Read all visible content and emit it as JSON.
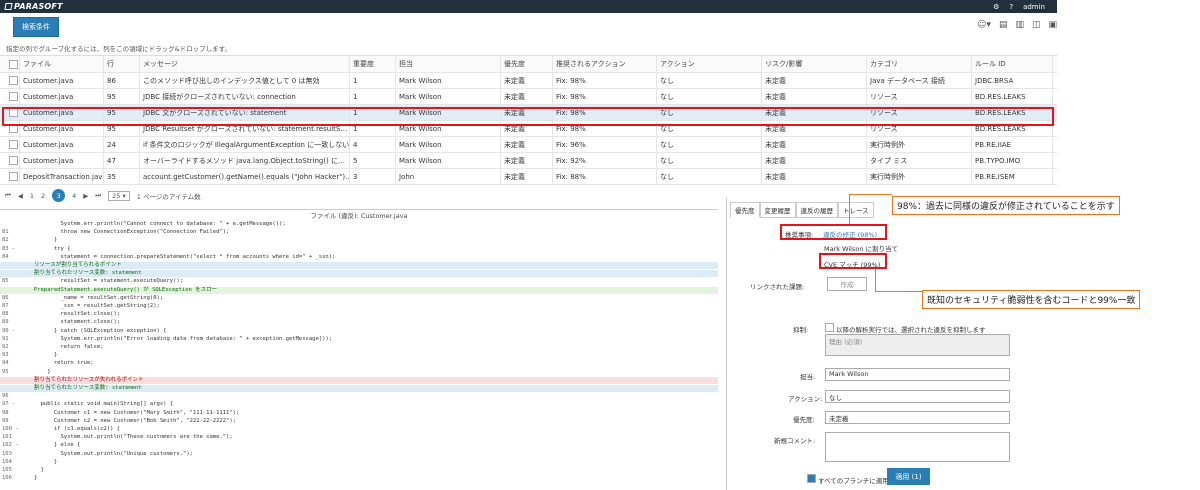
{
  "topbar": {
    "logo": "PARASOFT",
    "settings": "⚙",
    "help": "?",
    "user": "admin"
  },
  "search_button": "検索条件",
  "group_hint": "指定の列でグループ化するには、列をこの領域にドラッグ&ドロップします。",
  "grid": {
    "headers": [
      "ファイル",
      "行",
      "メッセージ",
      "重要度",
      "担当",
      "優先度",
      "推奨されるアクション",
      "アクション",
      "リスク/影響",
      "カテゴリ",
      "ルール ID"
    ],
    "rows": [
      [
        "Customer.java",
        "86",
        "このメソッド呼び出しのインデックス値として 0 は無効",
        "1",
        "Mark Wilson",
        "未定義",
        "Fix: 98%",
        "なし",
        "未定義",
        "Java データベース 接続",
        "JDBC.BRSA"
      ],
      [
        "Customer.java",
        "95",
        "JDBC 接続がクローズされていない: connection",
        "1",
        "Mark Wilson",
        "未定義",
        "Fix: 98%",
        "なし",
        "未定義",
        "リソース",
        "BD.RES.LEAKS"
      ],
      [
        "Customer.java",
        "95",
        "JDBC 文がクローズされていない: statement",
        "1",
        "Mark Wilson",
        "未定義",
        "Fix: 98%",
        "なし",
        "未定義",
        "リソース",
        "BD.RES.LEAKS"
      ],
      [
        "Customer.java",
        "95",
        "JDBC Resultset がクローズされていない: statement.resultS…",
        "1",
        "Mark Wilson",
        "未定義",
        "Fix: 98%",
        "なし",
        "未定義",
        "リソース",
        "BD.RES.LEAKS"
      ],
      [
        "Customer.java",
        "24",
        "if 条件文のロジックが IllegalArgumentException に一致しない",
        "4",
        "Mark Wilson",
        "未定義",
        "Fix: 96%",
        "なし",
        "未定義",
        "実行時例外",
        "PB.RE.IIAE"
      ],
      [
        "Customer.java",
        "47",
        "オーバーライドするメソッド java.lang.Object.toString() に…",
        "5",
        "Mark Wilson",
        "未定義",
        "Fix: 92%",
        "なし",
        "未定義",
        "タイプ ミス",
        "PB.TYPO.IMO"
      ],
      [
        "DepositTransaction.java",
        "35",
        "account.getCustomer().getName().equals (\"John Hacker\")…",
        "3",
        "John",
        "未定義",
        "Fix: 88%",
        "なし",
        "未定義",
        "実行時例外",
        "PB.RE.ISEM"
      ]
    ]
  },
  "pager": {
    "first": "⏮",
    "prev": "◀",
    "pages": [
      "1",
      "2",
      "3",
      "4"
    ],
    "current": "3",
    "next": "▶",
    "last": "⏭",
    "size": "25",
    "label": "1 ページのアイテム数"
  },
  "code": {
    "title": "ファイル (違反): Customer.java",
    "lines": [
      {
        "n": "",
        "t": "        System.err.println(\"Cannot connect to database: \" + e.getMessage());"
      },
      {
        "n": "81",
        "t": "        throw new ConnectionException(\"Connection Failed\");"
      },
      {
        "n": "82",
        "t": "      }"
      },
      {
        "n": "83 -",
        "t": "      try {"
      },
      {
        "n": "84",
        "t": "        statement = connection.prepareStatement(\"select * from accounts where id=\" + _ssn);"
      },
      {
        "n": "",
        "t": "リソースが割り当てられるポイント",
        "c": "g"
      },
      {
        "n": "",
        "t": "割り当てられたリソース変数: statement",
        "c": "g"
      },
      {
        "n": "85",
        "t": "        resultSet = statement.executeQuery();"
      },
      {
        "n": "",
        "t": "PreparedStatement.executeQuery() が SQLException をスロー",
        "c": "g2"
      },
      {
        "n": "86",
        "t": "        _name = resultSet.getString(0);"
      },
      {
        "n": "87",
        "t": "        _ssn = resultSet.getString(2);"
      },
      {
        "n": "88",
        "t": "        resultSet.close();"
      },
      {
        "n": "89",
        "t": "        statement.close();"
      },
      {
        "n": "90 -",
        "t": "      } catch (SQLException exception) {"
      },
      {
        "n": "91",
        "t": "        System.err.println(\"Error loading data from database: \" + exception.getMessage());"
      },
      {
        "n": "92",
        "t": "        return false;"
      },
      {
        "n": "93",
        "t": "      }"
      },
      {
        "n": "94",
        "t": "      return true;"
      },
      {
        "n": "95",
        "t": "    }"
      },
      {
        "n": "",
        "t": "割り当てられたリソースが失われるポイント",
        "c": "r"
      },
      {
        "n": "",
        "t": "割り当てられたリソース変数: statement",
        "c": "g"
      },
      {
        "n": "96",
        "t": ""
      },
      {
        "n": "97 -",
        "t": "  public static void main(String[] args) {"
      },
      {
        "n": "98",
        "t": "      Customer c1 = new Customer(\"Mary Smith\", \"111-11-1111\");"
      },
      {
        "n": "99",
        "t": "      Customer c2 = new Customer(\"Bob Smith\", \"222-22-2222\");"
      },
      {
        "n": "100 -",
        "t": "      if (c1.equals(c2)) {"
      },
      {
        "n": "101",
        "t": "        System.out.println(\"These customers are the same.\");"
      },
      {
        "n": "102 -",
        "t": "      } else {"
      },
      {
        "n": "103",
        "t": "        System.out.println(\"Unique customers.\");"
      },
      {
        "n": "104",
        "t": "      }"
      },
      {
        "n": "105",
        "t": "  }"
      },
      {
        "n": "106",
        "t": "}"
      }
    ]
  },
  "panel": {
    "tabs": [
      "優先度",
      "変更履歴",
      "違反の履歴",
      "トレース"
    ],
    "recommend_label": "推奨事項:",
    "recommend_value": "違反の修正 (98%)",
    "assigned": "Mark Wilson に割り当て",
    "cve": "CVE マッチ (99%)",
    "linked_label": "リンクされた課題:",
    "create_btn": "作成",
    "suppress_label": "抑制:",
    "suppress_text": "以降の解析実行では、選択された違反を抑制します",
    "reason_placeholder": "理由 (必須)",
    "owner_label": "担当:",
    "owner_value": "Mark Wilson",
    "action_label": "アクション:",
    "action_value": "なし",
    "priority_label": "優先度:",
    "priority_value": "未定義",
    "comment_label": "新規コメント:",
    "all_branches": "すべてのブランチに適用",
    "apply": "適用 (1)"
  },
  "callouts": {
    "c1": "98%：過去に同様の違反が修正されていることを示す",
    "c2": "既知のセキュリティ脆弱性を含むコードと99%一致"
  }
}
